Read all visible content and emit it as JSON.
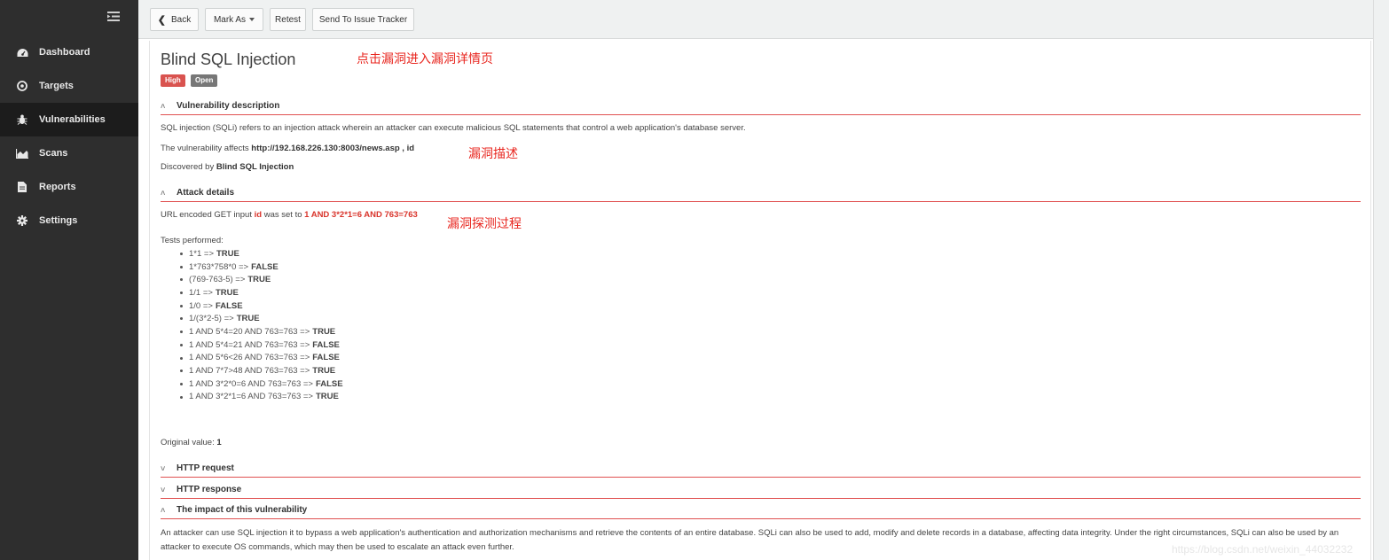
{
  "sidebar": {
    "items": [
      {
        "label": "Dashboard",
        "icon": "dashboard-icon"
      },
      {
        "label": "Targets",
        "icon": "target-icon"
      },
      {
        "label": "Vulnerabilities",
        "icon": "bug-icon"
      },
      {
        "label": "Scans",
        "icon": "area-chart-icon"
      },
      {
        "label": "Reports",
        "icon": "file-icon"
      },
      {
        "label": "Settings",
        "icon": "gear-icon"
      }
    ]
  },
  "toolbar": {
    "back_label": "Back",
    "mark_as_label": "Mark As",
    "retest_label": "Retest",
    "send_label": "Send To Issue Tracker"
  },
  "vuln": {
    "title": "Blind SQL Injection",
    "severity": "High",
    "status": "Open"
  },
  "sections": {
    "description": "Vulnerability description",
    "attack": "Attack details",
    "http_request": "HTTP request",
    "http_response": "HTTP response",
    "impact": "The impact of this vulnerability"
  },
  "description": {
    "text": "SQL injection (SQLi) refers to an injection attack wherein an attacker can execute malicious SQL statements that control a web application's database server.",
    "affects_prefix": "The vulnerability affects ",
    "affects_target": "http://192.168.226.130:8003/news.asp , id",
    "discovered_prefix": "Discovered by ",
    "discovered_by": "Blind SQL Injection"
  },
  "attack": {
    "line_prefix": "URL encoded GET input ",
    "param": "id",
    "line_mid": " was set to ",
    "payload": "1 AND 3*2*1=6 AND 763=763",
    "tests_label": "Tests performed:",
    "tests": [
      {
        "expr": "1*1 =>",
        "result": "TRUE"
      },
      {
        "expr": "1*763*758*0 =>",
        "result": "FALSE"
      },
      {
        "expr": "(769-763-5) =>",
        "result": "TRUE"
      },
      {
        "expr": "1/1 =>",
        "result": "TRUE"
      },
      {
        "expr": "1/0 =>",
        "result": "FALSE"
      },
      {
        "expr": "1/(3*2-5) =>",
        "result": "TRUE"
      },
      {
        "expr": "1 AND 5*4=20 AND 763=763 =>",
        "result": "TRUE"
      },
      {
        "expr": "1 AND 5*4=21 AND 763=763 =>",
        "result": "FALSE"
      },
      {
        "expr": "1 AND 5*6<26 AND 763=763 =>",
        "result": "FALSE"
      },
      {
        "expr": "1 AND 7*7>48 AND 763=763 =>",
        "result": "TRUE"
      },
      {
        "expr": "1 AND 3*2*0=6 AND 763=763 =>",
        "result": "FALSE"
      },
      {
        "expr": "1 AND 3*2*1=6 AND 763=763 =>",
        "result": "TRUE"
      }
    ],
    "original_prefix": "Original value: ",
    "original_value": "1"
  },
  "impact": {
    "text": "An attacker can use SQL injection it to bypass a web application's authentication and authorization mechanisms and retrieve the contents of an entire database. SQLi can also be used to add, modify and delete records in a database, affecting data integrity. Under the right circumstances, SQLi can also be used by an attacker to execute OS commands, which may then be used to escalate an attack even further."
  },
  "annotations": {
    "click_detail": "点击漏洞进入漏洞详情页",
    "vuln_description": "漏洞描述",
    "probe_process": "漏洞探测过程"
  },
  "watermark": "https://blog.csdn.net/weixin_44032232",
  "colors": {
    "sidebar_bg": "#2e2e2e",
    "sidebar_active": "#1c1c1c",
    "accent_red": "#d9342b",
    "severity_high": "#d9534f",
    "status_open": "#777777"
  }
}
